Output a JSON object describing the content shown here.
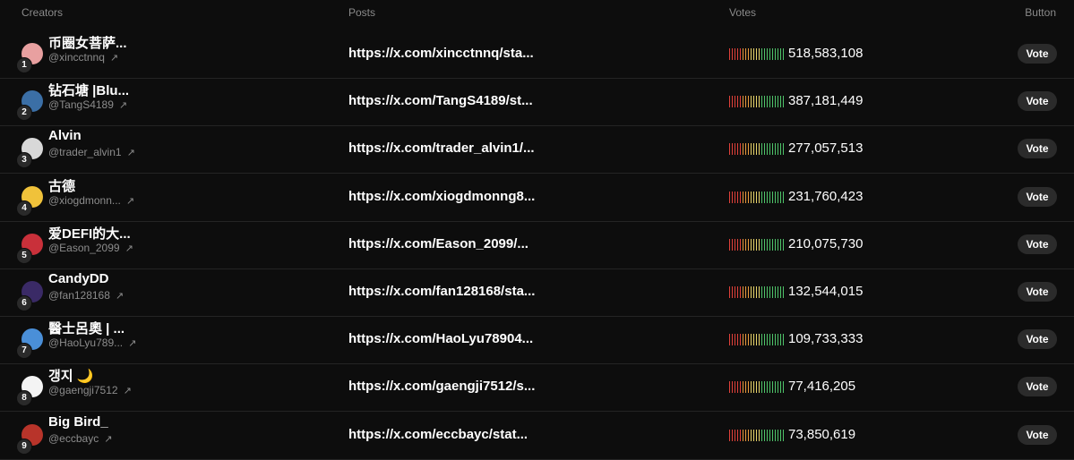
{
  "headers": {
    "creators": "Creators",
    "posts": "Posts",
    "votes": "Votes",
    "button": "Button"
  },
  "vote_label": "Vote",
  "arrow_glyph": "↗",
  "colors": {
    "background": "#0d0d0d",
    "bar_red": "#e0413a",
    "bar_orange": "#e89a3c",
    "bar_yellow": "#e7d36a",
    "bar_green": "#4fc46a",
    "button_bg": "#2b2b2b"
  },
  "rows": [
    {
      "rank": "1",
      "name": "币圈女菩萨...",
      "handle": "@xincctnnq",
      "post": "https://x.com/xincctnnq/sta...",
      "votes": "518,583,108",
      "avatar_color": "#e8a0a0"
    },
    {
      "rank": "2",
      "name": "钻石塘 |Blu...",
      "handle": "@TangS4189",
      "post": "https://x.com/TangS4189/st...",
      "votes": "387,181,449",
      "avatar_color": "#3b6fa6"
    },
    {
      "rank": "3",
      "name": "Alvin",
      "handle": "@trader_alvin1",
      "post": "https://x.com/trader_alvin1/...",
      "votes": "277,057,513",
      "avatar_color": "#d8d8d8"
    },
    {
      "rank": "4",
      "name": "古德",
      "handle": "@xiogdmonn...",
      "post": "https://x.com/xiogdmonng8...",
      "votes": "231,760,423",
      "avatar_color": "#f0c23a"
    },
    {
      "rank": "5",
      "name": "爱DEFI的大...",
      "handle": "@Eason_2099",
      "post": "https://x.com/Eason_2099/...",
      "votes": "210,075,730",
      "avatar_color": "#c9303a"
    },
    {
      "rank": "6",
      "name": "CandyDD",
      "handle": "@fan128168",
      "post": "https://x.com/fan128168/sta...",
      "votes": "132,544,015",
      "avatar_color": "#3a2a66"
    },
    {
      "rank": "7",
      "name": "醫士呂奧 | ...",
      "handle": "@HaoLyu789...",
      "post": "https://x.com/HaoLyu78904...",
      "votes": "109,733,333",
      "avatar_color": "#4a8fd8"
    },
    {
      "rank": "8",
      "name": "갱지 🌙",
      "handle": "@gaengji7512",
      "post": "https://x.com/gaengji7512/s...",
      "votes": "77,416,205",
      "avatar_color": "#f4f4f4"
    },
    {
      "rank": "9",
      "name": "Big Bird_",
      "handle": "@eccbayc",
      "post": "https://x.com/eccbayc/stat...",
      "votes": "73,850,619",
      "avatar_color": "#b8342a"
    }
  ]
}
